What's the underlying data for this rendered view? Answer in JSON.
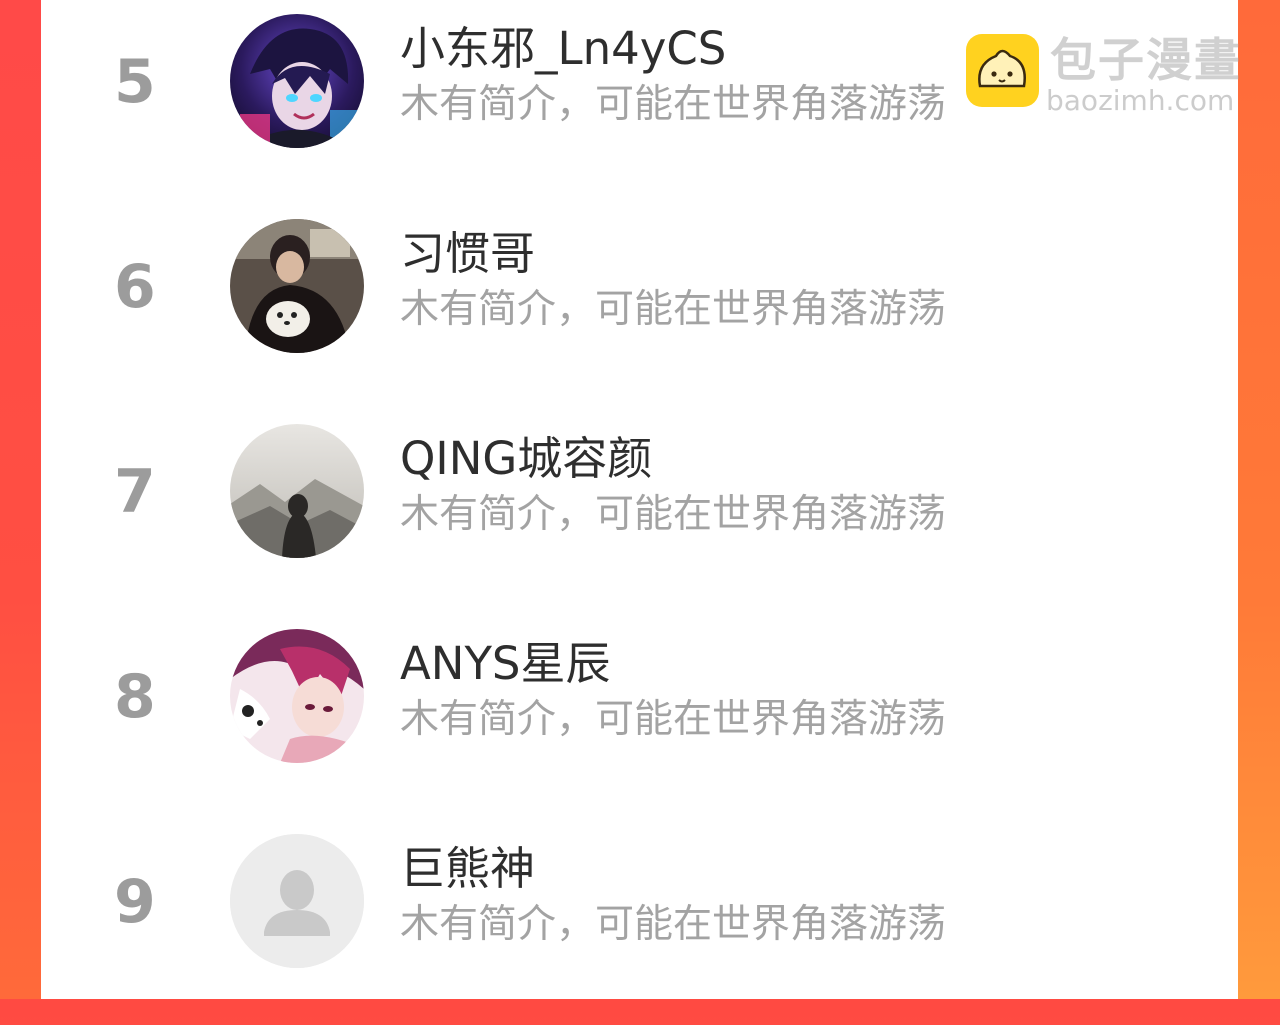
{
  "watermark": {
    "title": "包子漫畫",
    "url": "baozimh.com",
    "logo_icon": "baozi-bun-icon"
  },
  "ranking": {
    "items": [
      {
        "rank": "5",
        "name": "小东邪_Ln4yCS",
        "intro": "木有简介，可能在世界角落游荡",
        "avatar": "anime-avatar-purple"
      },
      {
        "rank": "6",
        "name": "习惯哥",
        "intro": "木有简介，可能在世界角落游荡",
        "avatar": "photo-avatar-person-with-dog"
      },
      {
        "rank": "7",
        "name": "QING城容颜",
        "intro": "木有简介，可能在世界角落游荡",
        "avatar": "photo-avatar-mountain-silhouette"
      },
      {
        "rank": "8",
        "name": "ANYS星辰",
        "intro": "木有简介，可能在世界角落游荡",
        "avatar": "anime-avatar-pink"
      },
      {
        "rank": "9",
        "name": "巨熊神",
        "intro": "木有简介，可能在世界角落游荡",
        "avatar": "default-user-icon"
      }
    ]
  },
  "colors": {
    "rank_text": "#9c9c9c",
    "name_text": "#2e2e2e",
    "intro_text": "#a3a3a3",
    "border_left": "#ff4a48",
    "border_right": "#ff7a38"
  }
}
